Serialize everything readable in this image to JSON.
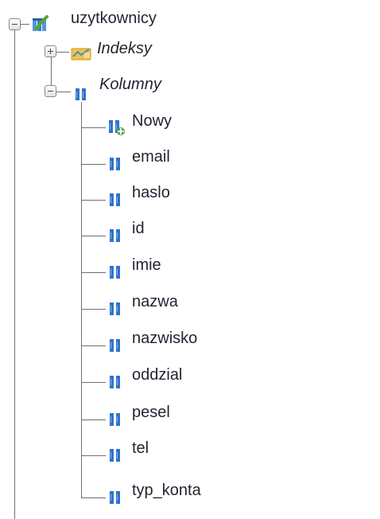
{
  "tree": {
    "table": {
      "label": "uzytkownicy",
      "icon": "table-icon"
    },
    "indexes": {
      "label": "Indeksy",
      "icon": "index-icon",
      "state": "collapsed"
    },
    "columns": {
      "label": "Kolumny",
      "icon": "columns-icon",
      "state": "expanded",
      "new_label": "Nowy",
      "new_icon": "new-column-icon",
      "items": [
        {
          "label": "email",
          "icon": "column-icon"
        },
        {
          "label": "haslo",
          "icon": "column-icon"
        },
        {
          "label": "id",
          "icon": "column-icon"
        },
        {
          "label": "imie",
          "icon": "column-icon"
        },
        {
          "label": "nazwa",
          "icon": "column-icon"
        },
        {
          "label": "nazwisko",
          "icon": "column-icon"
        },
        {
          "label": "oddzial",
          "icon": "column-icon"
        },
        {
          "label": "pesel",
          "icon": "column-icon"
        },
        {
          "label": "tel",
          "icon": "column-icon"
        },
        {
          "label": "typ_konta",
          "icon": "column-icon"
        }
      ]
    }
  },
  "colors": {
    "text": "#1f2430",
    "tree_line": "#6f6f6f",
    "column_icon": "#2f73c9"
  }
}
